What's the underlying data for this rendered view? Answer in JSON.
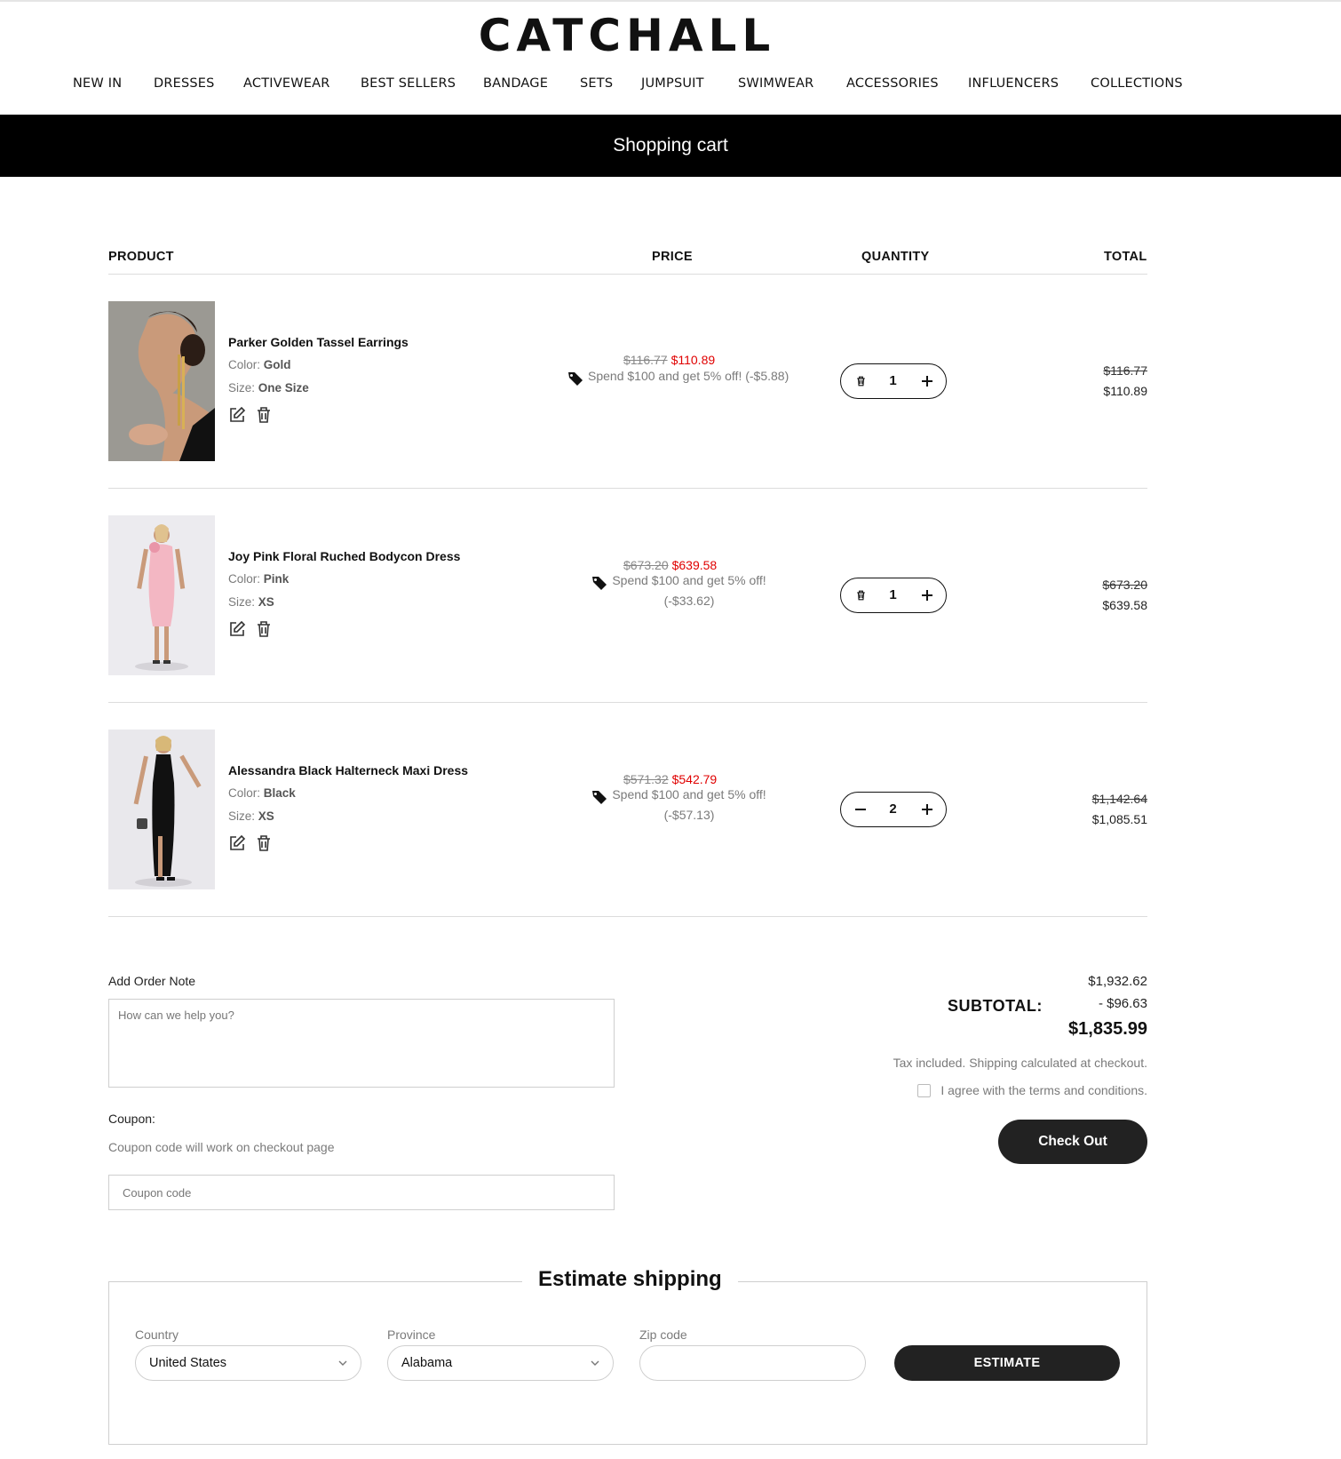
{
  "brand": {
    "logo_text": "CATCHALL"
  },
  "nav": {
    "items": [
      {
        "label": "NEW IN"
      },
      {
        "label": "DRESSES"
      },
      {
        "label": "ACTIVEWEAR"
      },
      {
        "label": "BEST SELLERS"
      },
      {
        "label": "BANDAGE"
      },
      {
        "label": "SETS"
      },
      {
        "label": "JUMPSUIT"
      },
      {
        "label": "SWIMWEAR"
      },
      {
        "label": "ACCESSORIES"
      },
      {
        "label": "INFLUENCERS"
      },
      {
        "label": "COLLECTIONS"
      }
    ]
  },
  "page_title": "Shopping cart",
  "table": {
    "headers": {
      "product": "PRODUCT",
      "price": "PRICE",
      "quantity": "QUANTITY",
      "total": "TOTAL"
    }
  },
  "cart": {
    "items": [
      {
        "name": "Parker Golden Tassel Earrings",
        "color_label": "Color: ",
        "color": "Gold",
        "size_label": "Size: ",
        "size": "One Size",
        "price_original": "$116.77",
        "price_sale": "$110.89",
        "promo_text": "Spend $100 and get 5% off! (-$5.88)",
        "quantity": "1",
        "total_original": "$116.77",
        "total": "$110.89",
        "image_icon": "earrings-model-photo"
      },
      {
        "name": "Joy Pink Floral Ruched Bodycon Dress",
        "color_label": "Color: ",
        "color": "Pink",
        "size_label": "Size: ",
        "size": "XS",
        "price_original": "$673.20",
        "price_sale": "$639.58",
        "promo_line1": "Spend $100 and get 5% off!",
        "promo_line2": "(-$33.62)",
        "quantity": "1",
        "total_original": "$673.20",
        "total": "$639.58",
        "image_icon": "pink-dress-model-photo"
      },
      {
        "name": "Alessandra Black Halterneck Maxi Dress",
        "color_label": "Color: ",
        "color": "Black",
        "size_label": "Size: ",
        "size": "XS",
        "price_original": "$571.32",
        "price_sale": "$542.79",
        "promo_line1": "Spend $100 and get 5% off!",
        "promo_line2": "(-$57.13)",
        "quantity": "2",
        "total_original": "$1,142.64",
        "total": "$1,085.51",
        "image_icon": "black-dress-model-photo"
      }
    ]
  },
  "order_note": {
    "label": "Add Order Note",
    "placeholder": "How can we help you?"
  },
  "coupon": {
    "label": "Coupon:",
    "hint": "Coupon code will work on checkout page",
    "placeholder": "Coupon code"
  },
  "summary": {
    "original": "$1,932.62",
    "discount": "- $96.63",
    "subtotal_label": "SUBTOTAL:",
    "total": "$1,835.99",
    "tax_note": "Tax included. Shipping calculated at checkout.",
    "terms_label": "I agree with the terms and conditions.",
    "checkout_label": "Check Out"
  },
  "shipping": {
    "title": "Estimate shipping",
    "country_label": "Country",
    "country_value": "United States",
    "province_label": "Province",
    "province_value": "Alabama",
    "zip_label": "Zip code",
    "zip_value": "",
    "button_label": "ESTIMATE"
  },
  "colors": {
    "sale_red": "#e00000",
    "dark": "#222222",
    "muted": "#7a7a7a"
  }
}
